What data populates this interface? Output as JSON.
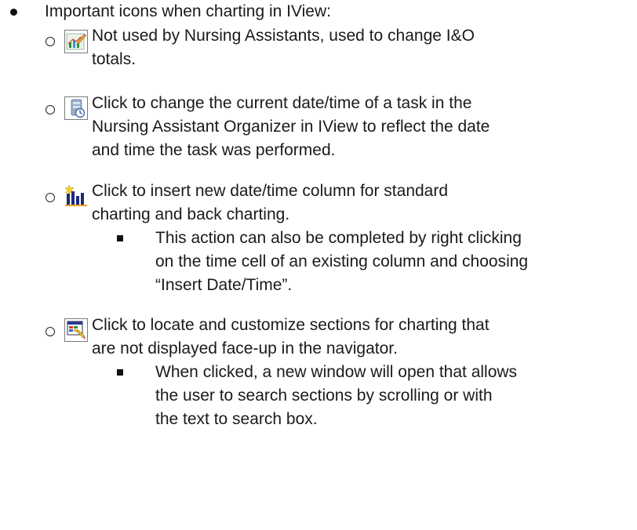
{
  "heading": "Important icons when charting in IView:",
  "items": [
    {
      "icon": "edit-totals-chart-icon",
      "lines": [
        "Not used by Nursing Assistants, used to change I&O",
        "totals."
      ]
    },
    {
      "icon": "change-datetime-icon",
      "lines": [
        "Click to change the current date/time of a task in the",
        "Nursing Assistant Organizer in IView to reflect the date",
        "and time the task was performed."
      ]
    },
    {
      "icon": "insert-column-icon",
      "lines": [
        "Click to insert new date/time column for standard",
        "charting and back charting."
      ],
      "sub": {
        "lines": [
          "This action can also be completed by right clicking",
          "on the time cell of an existing column and choosing",
          "“Insert Date/Time”."
        ]
      }
    },
    {
      "icon": "customize-sections-icon",
      "lines": [
        "Click to locate and customize sections for charting that",
        "are not displayed face-up in the navigator."
      ],
      "sub": {
        "lines": [
          "When clicked, a new window will open that allows",
          "the user to search sections by scrolling or with",
          "the text to search box."
        ]
      }
    }
  ]
}
